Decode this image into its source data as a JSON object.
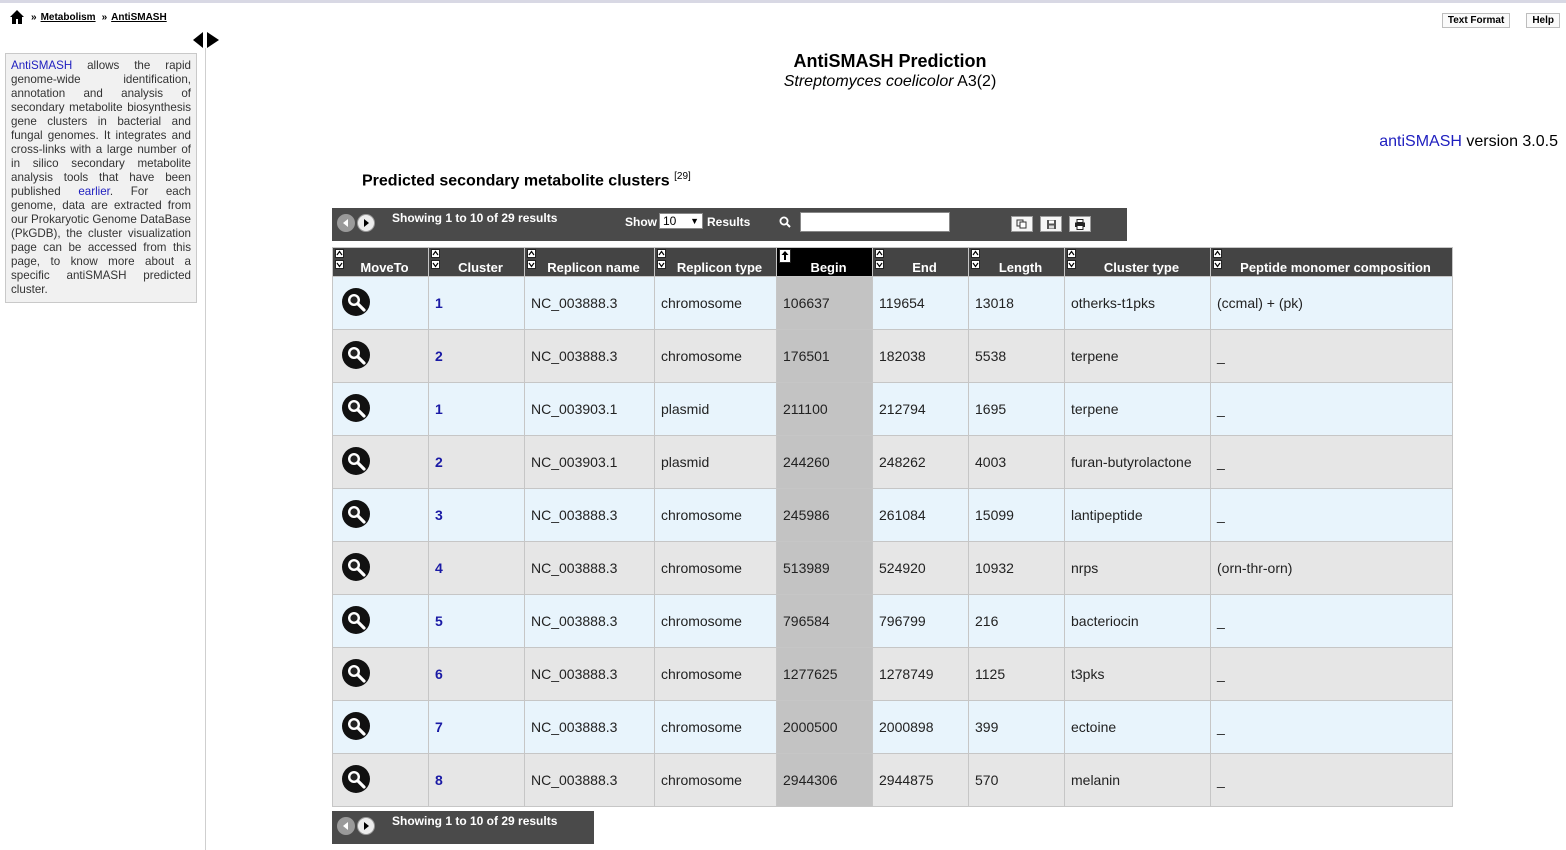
{
  "breadcrumb": {
    "sep": "»",
    "items": [
      "Metabolism",
      "AntiSMASH"
    ]
  },
  "top_buttons": {
    "text_format": "Text Format",
    "help": "Help"
  },
  "sidebar": {
    "link": "AntiSMASH",
    "text1": " allows the rapid genome-wide identification, annotation and analysis of secondary metabolite biosynthesis gene clusters in bacterial and fungal genomes. It integrates and cross-links with a large number of in silico secondary metabolite analysis tools that have been published ",
    "link2": "earlier",
    "text2": ". For each genome, data are extracted from our Prokaryotic Genome DataBase (PkGDB), the cluster visualization page can be accessed from this page, to know more about a specific antiSMASH predicted cluster."
  },
  "title": "AntiSMASH Prediction",
  "subtitle": {
    "species": "Streptomyces coelicolor",
    "strain": "A3(2)"
  },
  "version": {
    "link": "antiSMASH",
    "text": " version 3.0.5"
  },
  "section": {
    "title": "Predicted secondary metabolite clusters",
    "count": "[29]"
  },
  "toolbar": {
    "info": "Showing 1 to 10 of 29 results",
    "show_label": "Show",
    "show_value": "10",
    "results_label": "Results",
    "search_value": ""
  },
  "bottombar": {
    "info": "Showing 1 to 10 of 29 results"
  },
  "table": {
    "headers": [
      "MoveTo",
      "Cluster",
      "Replicon name",
      "Replicon type",
      "Begin",
      "End",
      "Length",
      "Cluster type",
      "Peptide monomer composition"
    ],
    "rows": [
      {
        "cluster": "1",
        "replicon": "NC_003888.3",
        "type": "chromosome",
        "begin": "106637",
        "end": "119654",
        "length": "13018",
        "ctype": "otherks-t1pks",
        "peptide": "(ccmal) + (pk)"
      },
      {
        "cluster": "2",
        "replicon": "NC_003888.3",
        "type": "chromosome",
        "begin": "176501",
        "end": "182038",
        "length": "5538",
        "ctype": "terpene",
        "peptide": "_"
      },
      {
        "cluster": "1",
        "replicon": "NC_003903.1",
        "type": "plasmid",
        "begin": "211100",
        "end": "212794",
        "length": "1695",
        "ctype": "terpene",
        "peptide": "_"
      },
      {
        "cluster": "2",
        "replicon": "NC_003903.1",
        "type": "plasmid",
        "begin": "244260",
        "end": "248262",
        "length": "4003",
        "ctype": "furan-butyrolactone",
        "peptide": "_"
      },
      {
        "cluster": "3",
        "replicon": "NC_003888.3",
        "type": "chromosome",
        "begin": "245986",
        "end": "261084",
        "length": "15099",
        "ctype": "lantipeptide",
        "peptide": "_"
      },
      {
        "cluster": "4",
        "replicon": "NC_003888.3",
        "type": "chromosome",
        "begin": "513989",
        "end": "524920",
        "length": "10932",
        "ctype": "nrps",
        "peptide": "(orn-thr-orn)"
      },
      {
        "cluster": "5",
        "replicon": "NC_003888.3",
        "type": "chromosome",
        "begin": "796584",
        "end": "796799",
        "length": "216",
        "ctype": "bacteriocin",
        "peptide": "_"
      },
      {
        "cluster": "6",
        "replicon": "NC_003888.3",
        "type": "chromosome",
        "begin": "1277625",
        "end": "1278749",
        "length": "1125",
        "ctype": "t3pks",
        "peptide": "_"
      },
      {
        "cluster": "7",
        "replicon": "NC_003888.3",
        "type": "chromosome",
        "begin": "2000500",
        "end": "2000898",
        "length": "399",
        "ctype": "ectoine",
        "peptide": "_"
      },
      {
        "cluster": "8",
        "replicon": "NC_003888.3",
        "type": "chromosome",
        "begin": "2944306",
        "end": "2944875",
        "length": "570",
        "ctype": "melanin",
        "peptide": "_"
      }
    ]
  },
  "icons": {
    "home": "home-icon",
    "moveto": "magnifier-icon",
    "sort": "sort-icon",
    "search": "search-icon",
    "copy": "copy-icon",
    "save": "save-icon",
    "print": "print-icon"
  },
  "colors": {
    "header_bg": "#444444",
    "row_odd": "#e8f4fc",
    "row_even": "#e6e6e6",
    "sorted_col": "#c3c3c3",
    "link": "#1e1ebf"
  }
}
